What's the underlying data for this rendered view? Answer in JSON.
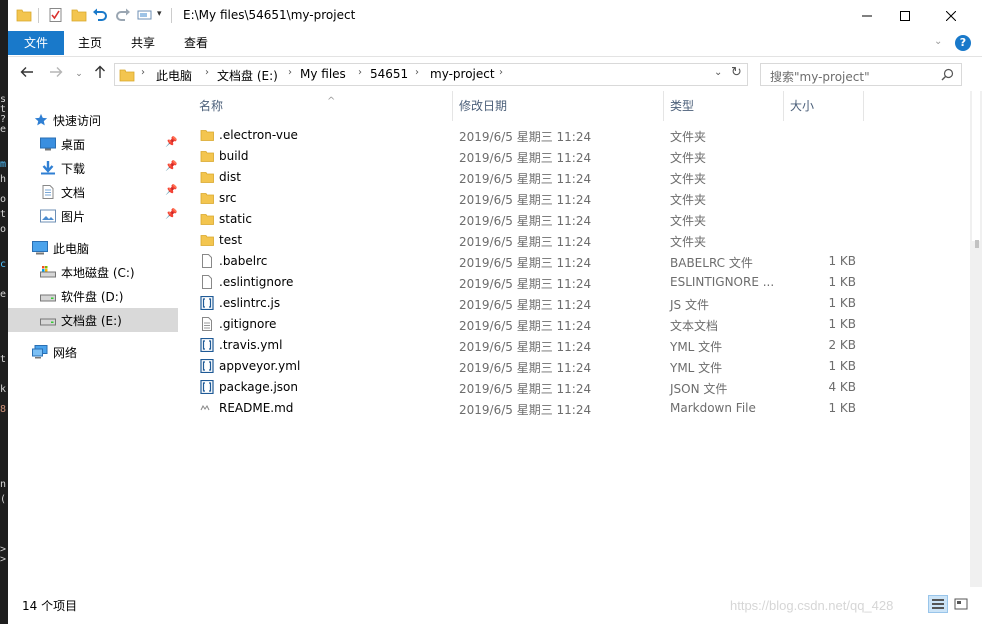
{
  "window": {
    "title": "E:\\My files\\54651\\my-project",
    "colors": {
      "ribbon_active": "#1979ca",
      "selected_nav": "#d9d9d9",
      "folder": "#f3c54f",
      "help": "#1979ca"
    }
  },
  "ribbon": {
    "tabs": [
      {
        "label": "文件",
        "active": true
      },
      {
        "label": "主页",
        "active": false
      },
      {
        "label": "共享",
        "active": false
      },
      {
        "label": "查看",
        "active": false
      }
    ]
  },
  "address": {
    "crumbs": [
      "此电脑",
      "文档盘 (E:)",
      "My files",
      "54651",
      "my-project"
    ]
  },
  "search": {
    "placeholder": "搜索\"my-project\""
  },
  "nav": {
    "quick_access": "快速访问",
    "quick_items": [
      {
        "label": "桌面",
        "icon": "desktop-icon"
      },
      {
        "label": "下载",
        "icon": "download-icon"
      },
      {
        "label": "文档",
        "icon": "document-icon"
      },
      {
        "label": "图片",
        "icon": "picture-icon"
      }
    ],
    "this_pc": "此电脑",
    "drives": [
      {
        "label": "本地磁盘 (C:)",
        "icon": "system-drive-icon"
      },
      {
        "label": "软件盘 (D:)",
        "icon": "drive-icon"
      },
      {
        "label": "文档盘 (E:)",
        "icon": "drive-icon",
        "selected": true
      }
    ],
    "network": "网络"
  },
  "columns": {
    "name": "名称",
    "date": "修改日期",
    "type": "类型",
    "size": "大小"
  },
  "files": [
    {
      "name": ".electron-vue",
      "date": "2019/6/5 星期三 11:24",
      "type": "文件夹",
      "size": "",
      "icon": "folder-icon"
    },
    {
      "name": "build",
      "date": "2019/6/5 星期三 11:24",
      "type": "文件夹",
      "size": "",
      "icon": "folder-icon"
    },
    {
      "name": "dist",
      "date": "2019/6/5 星期三 11:24",
      "type": "文件夹",
      "size": "",
      "icon": "folder-icon"
    },
    {
      "name": "src",
      "date": "2019/6/5 星期三 11:24",
      "type": "文件夹",
      "size": "",
      "icon": "folder-icon"
    },
    {
      "name": "static",
      "date": "2019/6/5 星期三 11:24",
      "type": "文件夹",
      "size": "",
      "icon": "folder-icon"
    },
    {
      "name": "test",
      "date": "2019/6/5 星期三 11:24",
      "type": "文件夹",
      "size": "",
      "icon": "folder-icon"
    },
    {
      "name": ".babelrc",
      "date": "2019/6/5 星期三 11:24",
      "type": "BABELRC 文件",
      "size": "1 KB",
      "icon": "file-icon"
    },
    {
      "name": ".eslintignore",
      "date": "2019/6/5 星期三 11:24",
      "type": "ESLINTIGNORE ...",
      "size": "1 KB",
      "icon": "file-icon"
    },
    {
      "name": ".eslintrc.js",
      "date": "2019/6/5 星期三 11:24",
      "type": "JS 文件",
      "size": "1 KB",
      "icon": "code-file-icon"
    },
    {
      "name": ".gitignore",
      "date": "2019/6/5 星期三 11:24",
      "type": "文本文档",
      "size": "1 KB",
      "icon": "text-file-icon"
    },
    {
      "name": ".travis.yml",
      "date": "2019/6/5 星期三 11:24",
      "type": "YML 文件",
      "size": "2 KB",
      "icon": "code-file-icon"
    },
    {
      "name": "appveyor.yml",
      "date": "2019/6/5 星期三 11:24",
      "type": "YML 文件",
      "size": "1 KB",
      "icon": "code-file-icon"
    },
    {
      "name": "package.json",
      "date": "2019/6/5 星期三 11:24",
      "type": "JSON 文件",
      "size": "4 KB",
      "icon": "code-file-icon"
    },
    {
      "name": "README.md",
      "date": "2019/6/5 星期三 11:24",
      "type": "Markdown File",
      "size": "1 KB",
      "icon": "markdown-file-icon"
    }
  ],
  "status": {
    "count": "14 个项目",
    "watermark": "https://blog.csdn.net/qq_428"
  }
}
